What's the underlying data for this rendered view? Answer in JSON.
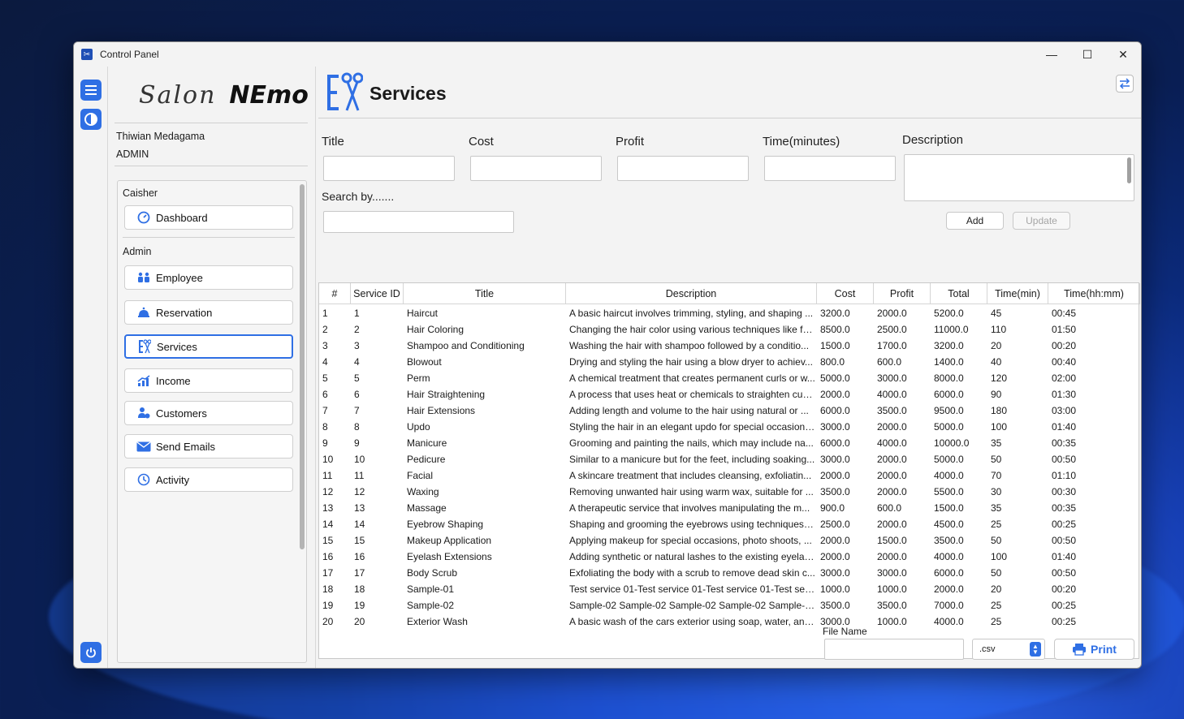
{
  "window": {
    "title": "Control Panel",
    "minimize": "—",
    "maximize": "☐",
    "close": "✕"
  },
  "sidebar": {
    "logo_script": "Salon",
    "logo_bold": "NEmo",
    "user_name": "Thiwian Medagama",
    "user_role": "ADMIN",
    "section_cashier": "Caisher",
    "section_admin": "Admin",
    "items": [
      {
        "label": "Dashboard",
        "icon": "gauge-icon"
      },
      {
        "label": "Employee",
        "icon": "people-icon"
      },
      {
        "label": "Reservation",
        "icon": "bell-icon"
      },
      {
        "label": "Services",
        "icon": "scissors-icon"
      },
      {
        "label": "Income",
        "icon": "chart-icon"
      },
      {
        "label": "Customers",
        "icon": "customer-icon"
      },
      {
        "label": "Send Emails",
        "icon": "mail-icon"
      },
      {
        "label": "Activity",
        "icon": "clock-icon"
      }
    ]
  },
  "page": {
    "title": "Services"
  },
  "form": {
    "title_label": "Title",
    "cost_label": "Cost",
    "profit_label": "Profit",
    "time_label": "Time(minutes)",
    "description_label": "Description",
    "search_label": "Search by.......",
    "add_label": "Add",
    "update_label": "Update"
  },
  "table": {
    "headers": [
      "#",
      "Service ID",
      "Title",
      "Description",
      "Cost",
      "Profit",
      "Total",
      "Time(min)",
      "Time(hh:mm)"
    ],
    "rows": [
      [
        "1",
        "1",
        "Haircut",
        "A basic haircut involves trimming, styling, and shaping ...",
        "3200.0",
        "2000.0",
        "5200.0",
        "45",
        "00:45"
      ],
      [
        "2",
        "2",
        "Hair Coloring",
        "Changing the hair color using various techniques like fu...",
        "8500.0",
        "2500.0",
        "11000.0",
        "110",
        "01:50"
      ],
      [
        "3",
        "3",
        "Shampoo and Conditioning",
        "Washing the hair with shampoo followed by a conditio...",
        "1500.0",
        "1700.0",
        "3200.0",
        "20",
        "00:20"
      ],
      [
        "4",
        "4",
        "Blowout",
        " Drying and styling the hair using a blow dryer to achiev...",
        "800.0",
        "600.0",
        "1400.0",
        "40",
        "00:40"
      ],
      [
        "5",
        "5",
        "Perm",
        "A chemical treatment that creates permanent curls or w...",
        "5000.0",
        "3000.0",
        "8000.0",
        "120",
        "02:00"
      ],
      [
        "6",
        "6",
        "Hair Straightening",
        "A process that uses heat or chemicals to straighten curl...",
        "2000.0",
        "4000.0",
        "6000.0",
        "90",
        "01:30"
      ],
      [
        "7",
        "7",
        "Hair Extensions",
        " Adding length and volume to the hair using natural or ...",
        "6000.0",
        "3500.0",
        "9500.0",
        "180",
        "03:00"
      ],
      [
        "8",
        "8",
        "Updo",
        "Styling the hair in an elegant updo for special occasions...",
        "3000.0",
        "2000.0",
        "5000.0",
        "100",
        "01:40"
      ],
      [
        "9",
        "9",
        "Manicure",
        "Grooming and painting the nails, which may include na...",
        "6000.0",
        "4000.0",
        "10000.0",
        "35",
        "00:35"
      ],
      [
        "10",
        "10",
        "Pedicure",
        "Similar to a manicure but for the feet, including soaking...",
        "3000.0",
        "2000.0",
        "5000.0",
        "50",
        "00:50"
      ],
      [
        "11",
        "11",
        "Facial",
        " A skincare treatment that includes cleansing, exfoliatin...",
        "2000.0",
        "2000.0",
        "4000.0",
        "70",
        "01:10"
      ],
      [
        "12",
        "12",
        "Waxing",
        "Removing unwanted hair using warm wax, suitable for ...",
        "3500.0",
        "2000.0",
        "5500.0",
        "30",
        "00:30"
      ],
      [
        "13",
        "13",
        "Massage",
        "A therapeutic service that involves manipulating the m...",
        "900.0",
        "600.0",
        "1500.0",
        "35",
        "00:35"
      ],
      [
        "14",
        "14",
        "Eyebrow Shaping",
        "Shaping and grooming the eyebrows using techniques l...",
        "2500.0",
        "2000.0",
        "4500.0",
        "25",
        "00:25"
      ],
      [
        "15",
        "15",
        "Makeup Application",
        "Applying makeup for special occasions, photo shoots, ...",
        "2000.0",
        "1500.0",
        "3500.0",
        "50",
        "00:50"
      ],
      [
        "16",
        "16",
        "Eyelash Extensions",
        "Adding synthetic or natural lashes to the existing eyelas...",
        "2000.0",
        "2000.0",
        "4000.0",
        "100",
        "01:40"
      ],
      [
        "17",
        "17",
        "Body Scrub",
        "Exfoliating the body with a scrub to remove dead skin c...",
        "3000.0",
        "3000.0",
        "6000.0",
        "50",
        "00:50"
      ],
      [
        "18",
        "18",
        "Sample-01",
        "Test service 01-Test service 01-Test service 01-Test servic...",
        "1000.0",
        "1000.0",
        "2000.0",
        "20",
        "00:20"
      ],
      [
        "19",
        "19",
        "Sample-02",
        "Sample-02 Sample-02 Sample-02 Sample-02 Sample-02...",
        "3500.0",
        "3500.0",
        "7000.0",
        "25",
        "00:25"
      ],
      [
        "20",
        "20",
        "Exterior Wash",
        "A basic wash of the cars exterior using soap, water, and ...",
        "3000.0",
        "1000.0",
        "4000.0",
        "25",
        "00:25"
      ]
    ]
  },
  "footer": {
    "file_name_label": "File Name",
    "file_name_value": "",
    "format_value": ".csv",
    "print_label": "Print"
  },
  "colors": {
    "accent": "#2f6fe4",
    "window_bg": "#f3f3f3"
  }
}
